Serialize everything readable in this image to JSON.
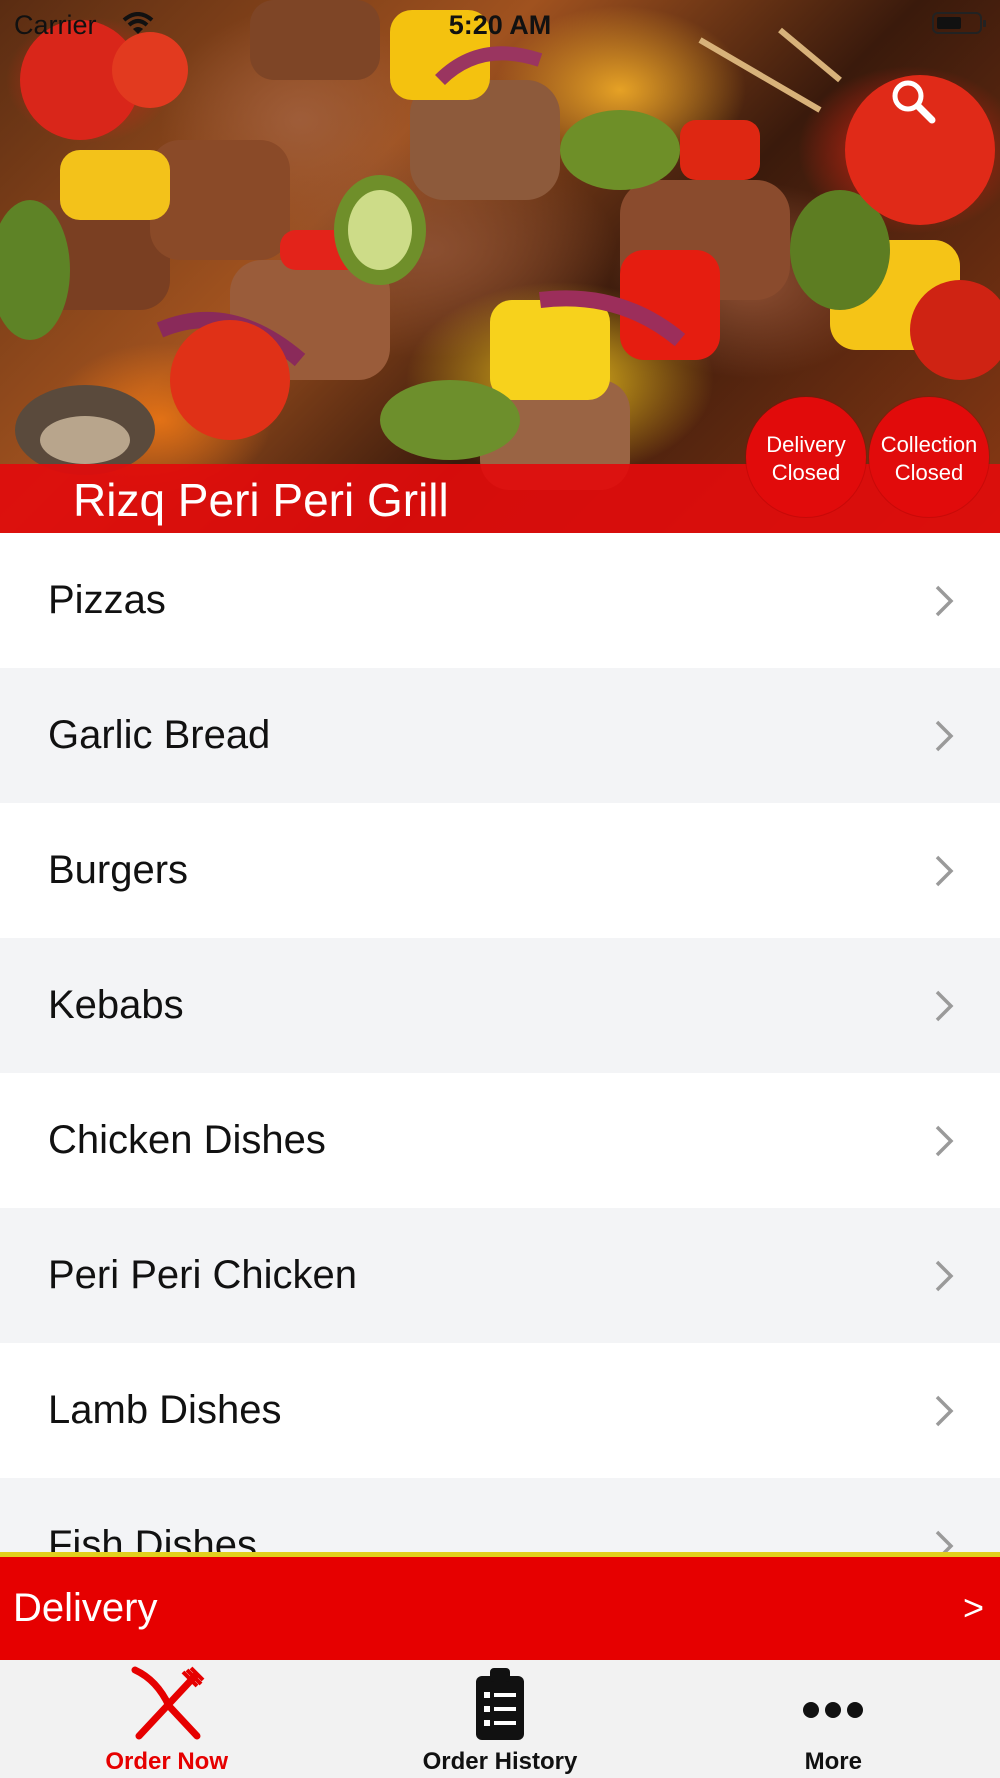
{
  "status_bar": {
    "carrier": "Carrier",
    "time": "5:20 AM"
  },
  "hero": {
    "restaurant_name": "Rizq Peri Peri Grill",
    "delivery_status": [
      "Delivery",
      "Closed"
    ],
    "collection_status": [
      "Collection",
      "Closed"
    ]
  },
  "menu": {
    "categories": [
      "Pizzas",
      "Garlic Bread",
      "Burgers",
      "Kebabs",
      "Chicken Dishes",
      "Peri Peri Chicken",
      "Lamb Dishes",
      "Fish Dishes"
    ]
  },
  "order_type_bar": {
    "label": "Delivery",
    "arrow": ">"
  },
  "tab_bar": {
    "tabs": [
      {
        "label": "Order Now",
        "icon": "fork-knife-icon",
        "active": true
      },
      {
        "label": "Order History",
        "icon": "clipboard-list-icon",
        "active": false
      },
      {
        "label": "More",
        "icon": "more-dots-icon",
        "active": false
      }
    ]
  },
  "colors": {
    "brand_red": "#e60000",
    "accent_yellow": "#e2cf1d",
    "row_alt": "#f3f4f6"
  }
}
